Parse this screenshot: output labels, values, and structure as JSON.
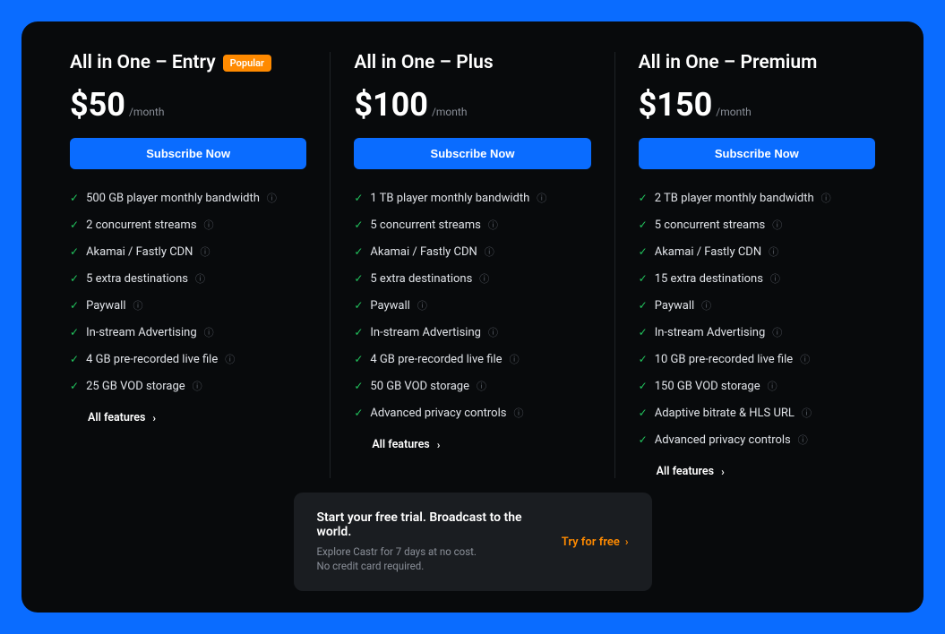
{
  "plans": [
    {
      "title": "All in One – Entry",
      "badge": "Popular",
      "price": "$50",
      "period": "/month",
      "cta": "Subscribe Now",
      "features": [
        "500 GB player monthly bandwidth",
        "2 concurrent streams",
        "Akamai / Fastly CDN",
        "5 extra destinations",
        "Paywall",
        "In-stream Advertising",
        "4 GB pre-recorded live file",
        "25 GB VOD storage"
      ],
      "all_features_label": "All features"
    },
    {
      "title": "All in One – Plus",
      "price": "$100",
      "period": "/month",
      "cta": "Subscribe Now",
      "features": [
        "1 TB player monthly bandwidth",
        "5 concurrent streams",
        "Akamai / Fastly CDN",
        "5 extra destinations",
        "Paywall",
        "In-stream Advertising",
        "4 GB pre-recorded live file",
        "50 GB VOD storage",
        "Advanced privacy controls"
      ],
      "all_features_label": "All features"
    },
    {
      "title": "All in One – Premium",
      "price": "$150",
      "period": "/month",
      "cta": "Subscribe Now",
      "features": [
        "2 TB player monthly bandwidth",
        "5 concurrent streams",
        "Akamai / Fastly CDN",
        "15 extra destinations",
        "Paywall",
        "In-stream Advertising",
        "10 GB pre-recorded live file",
        "150 GB VOD storage",
        "Adaptive bitrate & HLS URL",
        "Advanced privacy controls"
      ],
      "all_features_label": "All features"
    }
  ],
  "trial": {
    "headline": "Start your free trial. Broadcast to the world.",
    "sub1": "Explore Castr for 7 days at no cost.",
    "sub2": "No credit card required.",
    "cta": "Try for free"
  }
}
